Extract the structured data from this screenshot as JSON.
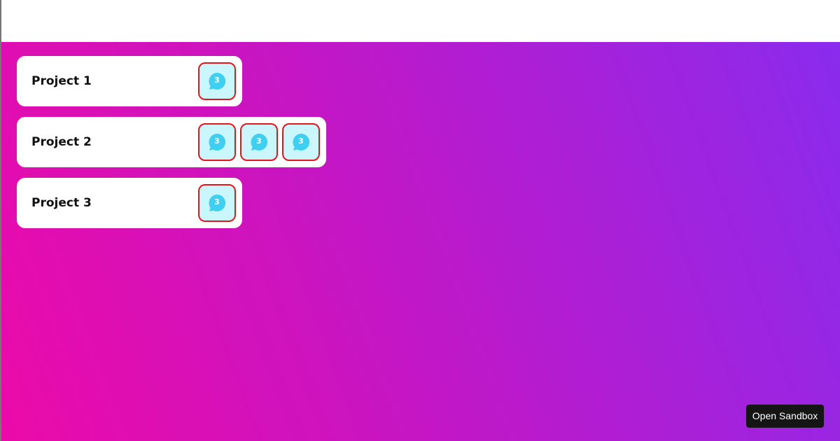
{
  "colors": {
    "gradient_start": "#ec0aa8",
    "gradient_end": "#8a2bed",
    "badge_border": "#e4161b",
    "badge_fill": "#c9f7fd",
    "chat_icon": "#3fd0f1"
  },
  "projects": [
    {
      "title": "Project 1",
      "badges": [
        {
          "icon": "chat-bubble-icon",
          "count": "3"
        }
      ]
    },
    {
      "title": "Project 2",
      "badges": [
        {
          "icon": "chat-bubble-icon",
          "count": "3"
        },
        {
          "icon": "chat-bubble-icon",
          "count": "3"
        },
        {
          "icon": "chat-bubble-icon",
          "count": "3"
        }
      ]
    },
    {
      "title": "Project 3",
      "badges": [
        {
          "icon": "chat-bubble-icon",
          "count": "3"
        }
      ]
    }
  ],
  "sandbox": {
    "label": "Open Sandbox"
  }
}
